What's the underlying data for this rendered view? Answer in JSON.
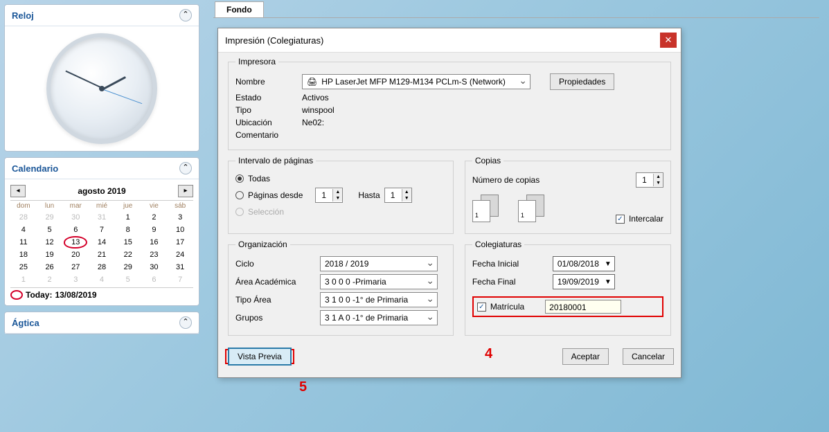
{
  "sidebar": {
    "reloj_title": "Reloj",
    "calendario_title": "Calendario",
    "cal_month": "agosto 2019",
    "cal_dow": [
      "dom",
      "lun",
      "mar",
      "mié",
      "jue",
      "vie",
      "sáb"
    ],
    "cal_days": [
      {
        "n": 28,
        "o": true
      },
      {
        "n": 29,
        "o": true
      },
      {
        "n": 30,
        "o": true
      },
      {
        "n": 31,
        "o": true
      },
      {
        "n": 1
      },
      {
        "n": 2
      },
      {
        "n": 3
      },
      {
        "n": 4
      },
      {
        "n": 5
      },
      {
        "n": 6
      },
      {
        "n": 7
      },
      {
        "n": 8
      },
      {
        "n": 9
      },
      {
        "n": 10
      },
      {
        "n": 11
      },
      {
        "n": 12
      },
      {
        "n": 13,
        "t": true
      },
      {
        "n": 14
      },
      {
        "n": 15
      },
      {
        "n": 16
      },
      {
        "n": 17
      },
      {
        "n": 18
      },
      {
        "n": 19
      },
      {
        "n": 20
      },
      {
        "n": 21
      },
      {
        "n": 22
      },
      {
        "n": 23
      },
      {
        "n": 24
      },
      {
        "n": 25
      },
      {
        "n": 26
      },
      {
        "n": 27
      },
      {
        "n": 28
      },
      {
        "n": 29
      },
      {
        "n": 30
      },
      {
        "n": 31
      },
      {
        "n": 1,
        "o": true
      },
      {
        "n": 2,
        "o": true
      },
      {
        "n": 3,
        "o": true
      },
      {
        "n": 4,
        "o": true
      },
      {
        "n": 5,
        "o": true
      },
      {
        "n": 6,
        "o": true
      },
      {
        "n": 7,
        "o": true
      }
    ],
    "today_label": "Today:",
    "today_date": "13/08/2019",
    "agtica_title": "Ágtica"
  },
  "tab_label": "Fondo",
  "dialog": {
    "title": "Impresión (Colegiaturas)",
    "impresora": {
      "legend": "Impresora",
      "nombre_label": "Nombre",
      "nombre_value": "HP LaserJet MFP M129-M134 PCLm-S (Network)",
      "propiedades_btn": "Propiedades",
      "estado_label": "Estado",
      "estado_value": "Activos",
      "tipo_label": "Tipo",
      "tipo_value": "winspool",
      "ubicacion_label": "Ubicación",
      "ubicacion_value": "Ne02:",
      "comentario_label": "Comentario",
      "comentario_value": ""
    },
    "intervalo": {
      "legend": "Intervalo de páginas",
      "todas": "Todas",
      "desde": "Páginas desde",
      "desde_val": "1",
      "hasta": "Hasta",
      "hasta_val": "1",
      "seleccion": "Selección"
    },
    "copias": {
      "legend": "Copias",
      "numero_label": "Número de copias",
      "numero_val": "1",
      "intercalar": "Intercalar",
      "pg_labels": [
        "1",
        "1"
      ]
    },
    "org": {
      "legend": "Organización",
      "ciclo_label": "Ciclo",
      "ciclo_val": "2018 / 2019",
      "area_label": "Área Académica",
      "area_val": "3 0 0 0  -Primaria",
      "tipoarea_label": "Tipo Área",
      "tipoarea_val": "3 1 0 0  -1° de Primaria",
      "grupos_label": "Grupos",
      "grupos_val": "3 1 A 0  -1° de Primaria"
    },
    "coleg": {
      "legend": "Colegiaturas",
      "fini_label": "Fecha Inicial",
      "fini_val": "01/08/2018",
      "ffin_label": "Fecha Final",
      "ffin_val": "19/09/2019",
      "matricula_label": "Matrícula",
      "matricula_val": "20180001"
    },
    "buttons": {
      "vista": "Vista Previa",
      "aceptar": "Aceptar",
      "cancelar": "Cancelar"
    }
  },
  "annotations": {
    "a4": "4",
    "a5": "5"
  }
}
